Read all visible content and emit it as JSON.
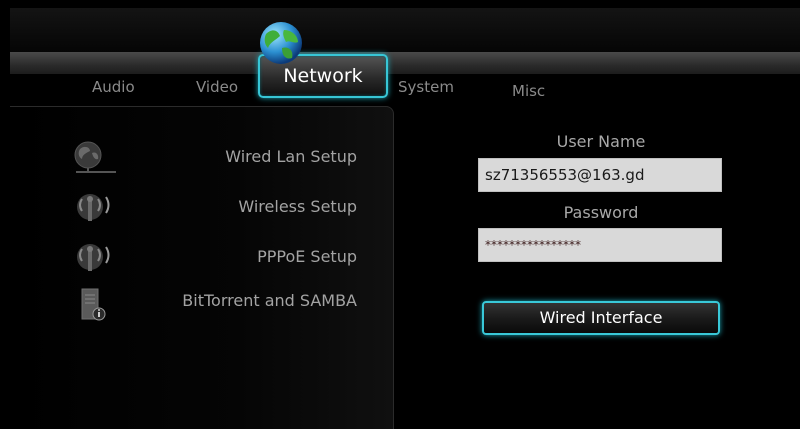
{
  "tabs": [
    {
      "label": "Audio"
    },
    {
      "label": "Video"
    },
    {
      "label": "Network"
    },
    {
      "label": "System"
    },
    {
      "label": "Misc"
    }
  ],
  "menu": [
    {
      "label": "Wired Lan Setup",
      "icon": "network-globe-icon"
    },
    {
      "label": "Wireless Setup",
      "icon": "wireless-antenna-icon"
    },
    {
      "label": "PPPoE Setup",
      "icon": "wireless-antenna-icon"
    },
    {
      "label": "BitTorrent and SAMBA",
      "icon": "server-info-icon"
    }
  ],
  "form": {
    "username_label": "User Name",
    "username_value": "sz71356553@163.gd",
    "password_label": "Password",
    "password_value": "****************",
    "button_label": "Wired Interface"
  },
  "colors": {
    "accent": "#37c6d6",
    "field_bg": "#d9d9d9"
  }
}
